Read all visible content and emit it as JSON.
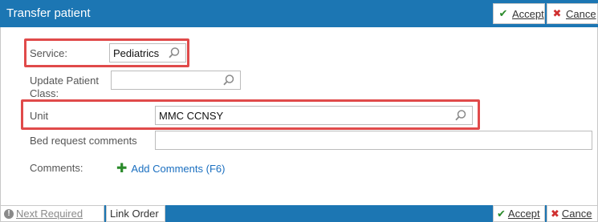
{
  "dialog": {
    "title": "Transfer patient",
    "accept_label": "Accept",
    "cancel_label": "Cance"
  },
  "form": {
    "service": {
      "label": "Service:",
      "value": "Pediatrics"
    },
    "patient_class": {
      "label_line1": "Update Patient",
      "label_line2": "Class:",
      "value": ""
    },
    "unit": {
      "label": "Unit",
      "value": "MMC CCNSY"
    },
    "bed_request": {
      "label": "Bed request comments",
      "value": ""
    },
    "comments": {
      "label": "Comments:",
      "add_label": "Add Comments (F6)"
    }
  },
  "footer": {
    "next_required_label": "Next Required",
    "link_order_label": "Link Order",
    "accept_label": "Accept",
    "cancel_label": "Cance"
  },
  "colors": {
    "titlebar": "#1c76b3",
    "highlight": "#e04a4a",
    "accept_check": "#2a8a2a",
    "cancel_x": "#d03030",
    "link": "#1a6fc0"
  }
}
